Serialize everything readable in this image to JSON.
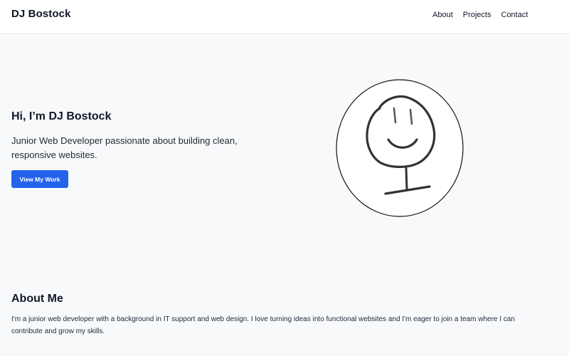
{
  "nav": {
    "brand": "DJ Bostock",
    "links": [
      "About",
      "Projects",
      "Contact"
    ]
  },
  "hero": {
    "title": "Hi, I’m DJ Bostock",
    "subtitle": "Junior Web Developer passionate about building clean, responsive websites.",
    "button_label": "View My Work",
    "avatar_icon": "hand-drawn-smiley-face-icon"
  },
  "about": {
    "title": "About Me",
    "text": "I'm a junior web developer with a background in IT support and web design. I love turning ideas into functional websites and I'm eager to join a team where I can contribute and grow my skills."
  },
  "colors": {
    "accent": "#2563eb",
    "background": "#f8f9fb",
    "text": "#111827"
  }
}
